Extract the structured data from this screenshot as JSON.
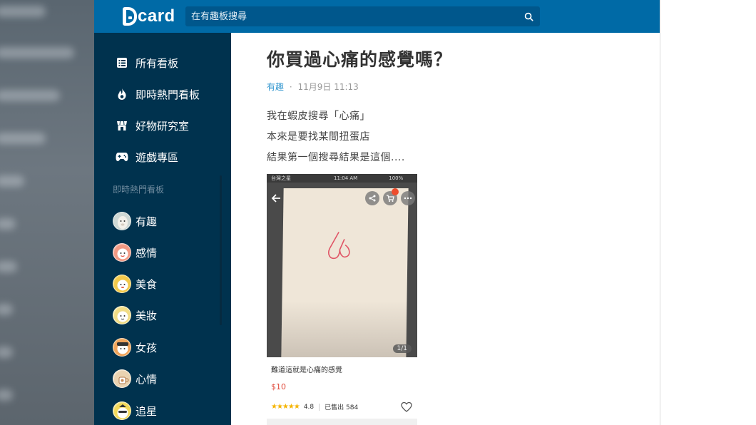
{
  "header": {
    "logo_text": "card",
    "search_placeholder": "在有趣板搜尋",
    "accent_color": "#006aa6"
  },
  "sidebar": {
    "nav_items": [
      {
        "label": "所有看板",
        "icon": "list-icon"
      },
      {
        "label": "即時熱門看板",
        "icon": "flame-icon"
      },
      {
        "label": "好物研究室",
        "icon": "store-icon"
      },
      {
        "label": "遊戲專區",
        "icon": "gamepad-icon"
      }
    ],
    "section_title": "即時熱門看板",
    "boards": [
      {
        "label": "有趣",
        "icon": "alpaca-avatar-icon"
      },
      {
        "label": "感情",
        "icon": "heart-face-avatar-icon"
      },
      {
        "label": "美食",
        "icon": "food-avatar-icon"
      },
      {
        "label": "美妝",
        "icon": "makeup-avatar-icon"
      },
      {
        "label": "女孩",
        "icon": "girl-avatar-icon"
      },
      {
        "label": "心情",
        "icon": "cup-avatar-icon"
      },
      {
        "label": "追星",
        "icon": "star-avatar-icon"
      }
    ]
  },
  "article": {
    "title": "你買過心痛的感覺嗎？",
    "board": "有趣",
    "separator": "·",
    "date": "11月9日 11:13",
    "lines": [
      "我在蝦皮搜尋「心痛」",
      "本來是要找某間扭蛋店",
      "結果第一個搜尋結果是這個...."
    ]
  },
  "embedded_screenshot": {
    "status_left": "台灣之星",
    "status_time": "11:04 AM",
    "status_battery": "100%",
    "image_counter": "1/1",
    "product_name": "難道這就是心痛的感覺",
    "price": "$10",
    "stars": "★★★★★",
    "rating": "4.8",
    "sold": "已售出 584"
  }
}
